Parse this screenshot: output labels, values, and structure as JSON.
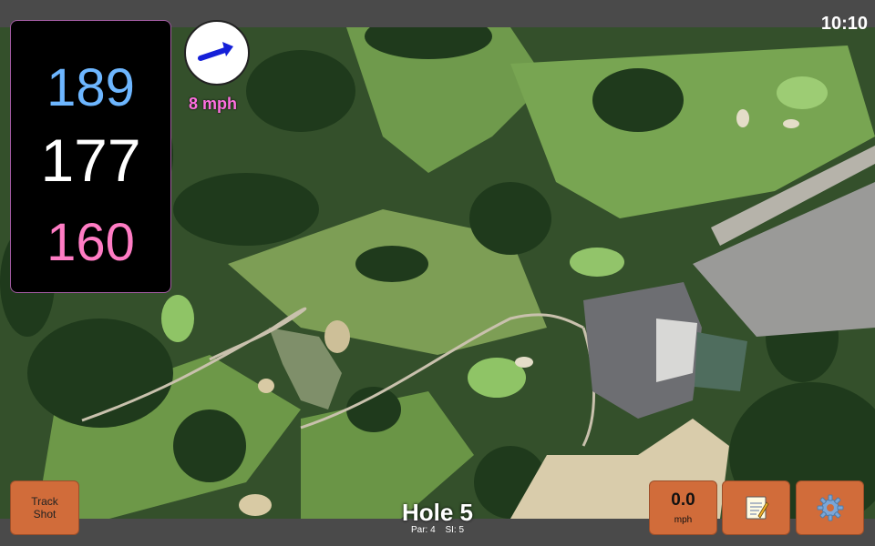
{
  "status": {
    "time": "10:10"
  },
  "distances": {
    "back": "189",
    "middle": "177",
    "front": "160"
  },
  "wind": {
    "speed_label": "8 mph",
    "direction": "east-northeast",
    "icon": "arrow-icon"
  },
  "hole": {
    "title": "Hole 5",
    "par_label": "Par: 4",
    "si_label": "SI: 5"
  },
  "buttons": {
    "track_shot": {
      "line1": "Track",
      "line2": "Shot"
    },
    "speed": {
      "value": "0.0",
      "unit": "mph"
    },
    "notes": {
      "icon": "notepad-icon"
    },
    "settings": {
      "icon": "gear-icon"
    }
  },
  "colors": {
    "back_distance": "#6db6ff",
    "middle_distance": "#ffffff",
    "front_distance": "#ff7cc4",
    "wind_text": "#ff6fe0",
    "button_fill": "#d16c3a"
  }
}
